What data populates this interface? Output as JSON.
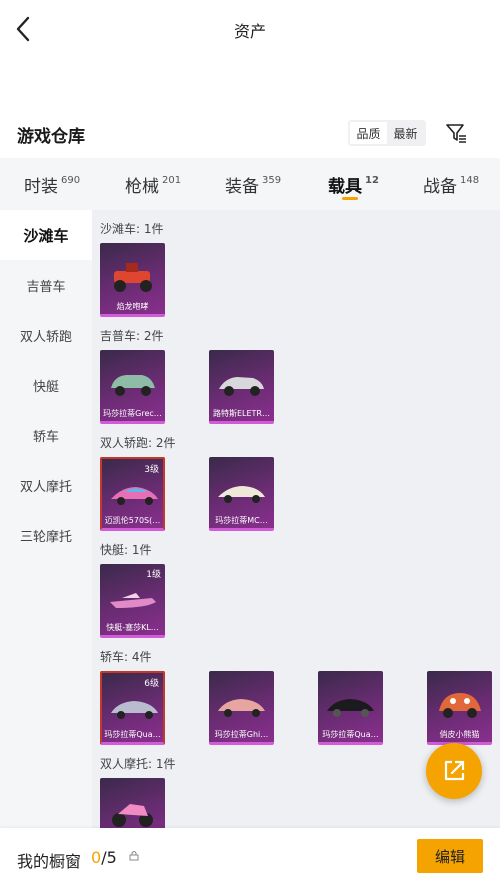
{
  "header": {
    "title": "资产"
  },
  "warehouse": {
    "title": "游戏仓库",
    "sort_options": [
      "品质",
      "最新"
    ],
    "filter_icon": "filter-icon"
  },
  "tabs": [
    {
      "label": "时装",
      "count": "690"
    },
    {
      "label": "枪械",
      "count": "201"
    },
    {
      "label": "装备",
      "count": "359"
    },
    {
      "label": "载具",
      "count": "12"
    },
    {
      "label": "战备",
      "count": "148"
    }
  ],
  "active_tab": "载具",
  "sidebar": {
    "items": [
      "沙滩车",
      "吉普车",
      "双人轿跑",
      "快艇",
      "轿车",
      "双人摩托",
      "三轮摩托"
    ],
    "active": "沙滩车"
  },
  "sections": [
    {
      "label": "沙滩车: 1件",
      "items": [
        {
          "name": "焰龙咆哮",
          "level": ""
        }
      ]
    },
    {
      "label": "吉普车: 2件",
      "items": [
        {
          "name": "玛莎拉蒂Grec…",
          "level": ""
        },
        {
          "name": "路特斯ELETR…",
          "level": ""
        }
      ]
    },
    {
      "label": "双人轿跑: 2件",
      "items": [
        {
          "name": "迈凯伦570S(…",
          "level": "3级"
        },
        {
          "name": "玛莎拉蒂MC…",
          "level": ""
        }
      ]
    },
    {
      "label": "快艇: 1件",
      "items": [
        {
          "name": "快艇-塞莎KL…",
          "level": "1级"
        }
      ]
    },
    {
      "label": "轿车: 4件",
      "items": [
        {
          "name": "玛莎拉蒂Qua…",
          "level": "6级"
        },
        {
          "name": "玛莎拉蒂Ghi…",
          "level": ""
        },
        {
          "name": "玛莎拉蒂Qua…",
          "level": ""
        },
        {
          "name": "俏皮小熊猫",
          "level": ""
        }
      ]
    },
    {
      "label": "双人摩托: 1件",
      "items": [
        {
          "name": "",
          "level": ""
        }
      ]
    }
  ],
  "bottom": {
    "label": "我的橱窗",
    "count_current": "0",
    "count_total": "/5",
    "edit_label": "编辑"
  },
  "colors": {
    "accent": "#f5a300",
    "card_purple": "#6a2c73"
  }
}
